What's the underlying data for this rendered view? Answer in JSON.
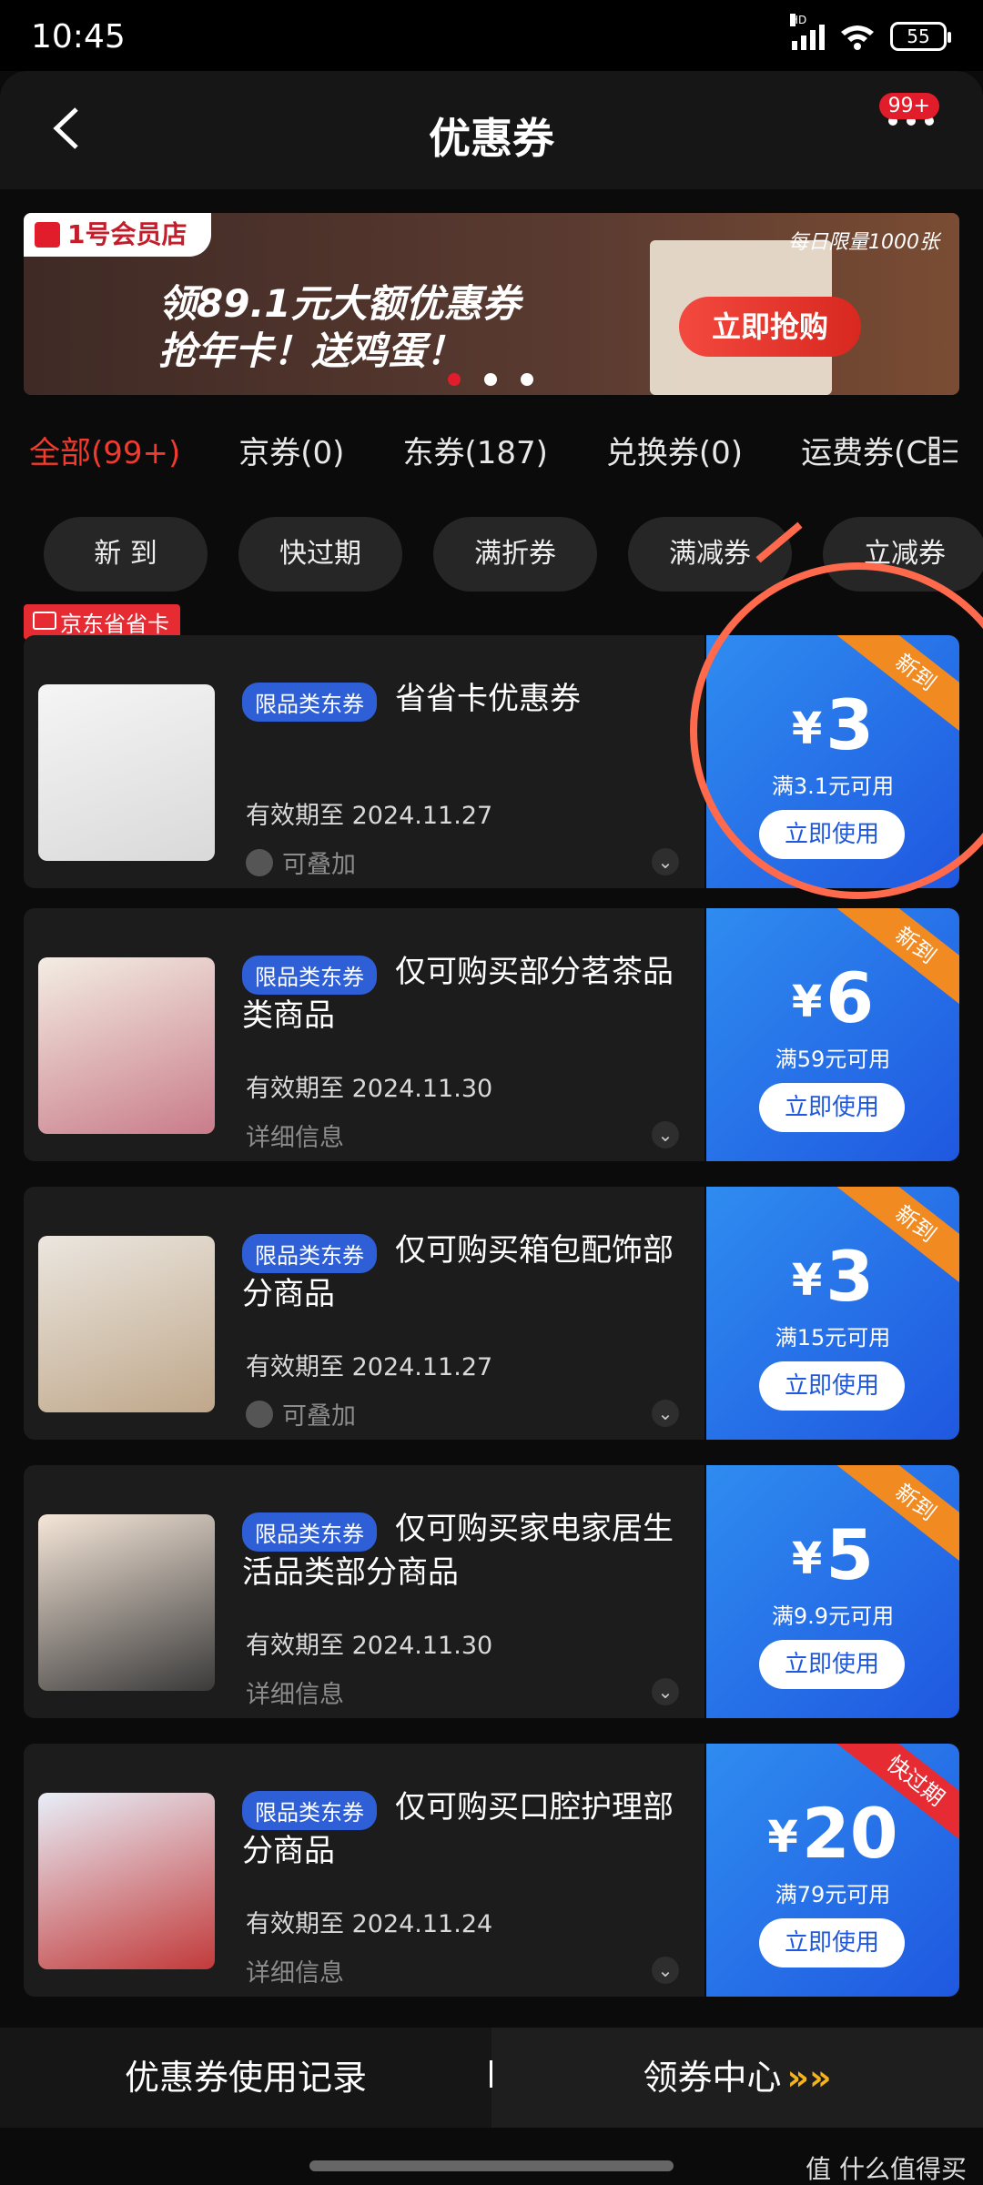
{
  "status": {
    "time": "10:45",
    "network": "HD",
    "battery": "55"
  },
  "header": {
    "title": "优惠券",
    "badge": "99+"
  },
  "banner": {
    "logo_text": "1号会员店",
    "line1": "领89.1元大额优惠券",
    "line2": "抢年卡！送鸡蛋！",
    "limit_text": "每日限量1000张",
    "cta": "立即抢购"
  },
  "tabs": [
    {
      "label": "全部(99+)"
    },
    {
      "label": "京券(0)"
    },
    {
      "label": "东券(187)"
    },
    {
      "label": "兑换券(0)"
    },
    {
      "label": "运费券(C"
    }
  ],
  "chips": [
    "新 到",
    "快过期",
    "满折券",
    "满减券",
    "立减券"
  ],
  "coupons": [
    {
      "card_label": "京东省省卡",
      "tag": "限品类东券",
      "title": "省省卡优惠券",
      "expiry": "有效期至 2024.11.27",
      "extra": "可叠加",
      "amount": "3",
      "condition": "满3.1元可用",
      "button": "立即使用",
      "corner": "新到"
    },
    {
      "tag": "限品类东券",
      "title": "仅可购买部分茗茶品类商品",
      "expiry": "有效期至 2024.11.30",
      "extra": "详细信息",
      "amount": "6",
      "condition": "满59元可用",
      "button": "立即使用",
      "corner": "新到"
    },
    {
      "tag": "限品类东券",
      "title": "仅可购买箱包配饰部分商品",
      "expiry": "有效期至 2024.11.27",
      "extra": "可叠加",
      "amount": "3",
      "condition": "满15元可用",
      "button": "立即使用",
      "corner": "新到"
    },
    {
      "tag": "限品类东券",
      "title": "仅可购买家电家居生活品类部分商品",
      "expiry": "有效期至 2024.11.30",
      "extra": "详细信息",
      "amount": "5",
      "condition": "满9.9元可用",
      "button": "立即使用",
      "corner": "新到"
    },
    {
      "tag": "限品类东券",
      "title": "仅可购买口腔护理部分商品",
      "expiry": "有效期至 2024.11.24",
      "extra": "详细信息",
      "amount": "20",
      "condition": "满79元可用",
      "button": "立即使用",
      "corner": "快过期"
    }
  ],
  "currency": "¥",
  "bottom": {
    "left": "优惠券使用记录",
    "right": "领券中心",
    "right_arrows": "»»"
  },
  "watermark": "值 什么值得买",
  "colors": {
    "accent_red": "#f23a2e",
    "coupon_blue": "#1f58e0",
    "corner_orange": "#f18a20",
    "corner_red": "#e72b33"
  }
}
